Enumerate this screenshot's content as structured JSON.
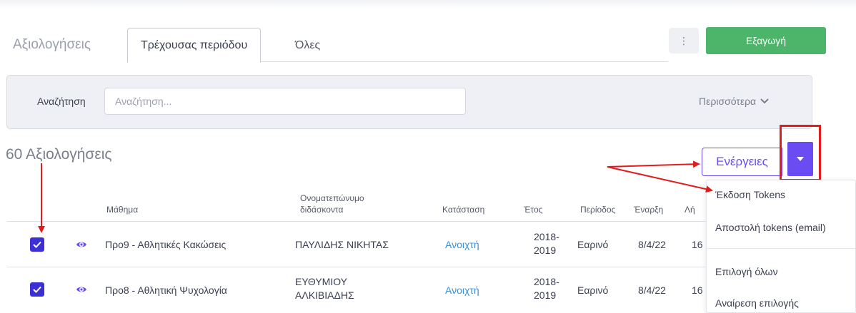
{
  "header": {
    "title": "Αξιολογήσεις",
    "tabs": [
      {
        "label": "Τρέχουσας περιόδου",
        "active": true
      },
      {
        "label": "Όλες",
        "active": false
      }
    ],
    "kebab_icon": "ellipsis-vertical-icon",
    "export_label": "Εξαγωγή"
  },
  "search": {
    "label": "Αναζήτηση",
    "placeholder": "Αναζήτηση...",
    "value": "",
    "more_label": "Περισσότερα"
  },
  "results": {
    "count_label": "60 Αξιολογήσεις",
    "actions_label": "Ενέργειες"
  },
  "table": {
    "columns": [
      "Μάθημα",
      "Ονοματεπώνυμο\nδιδάσκοντα",
      "Κατάσταση",
      "Έτος",
      "Περίοδος",
      "Έναρξη",
      "Λή"
    ],
    "rows": [
      {
        "course": "Προ9 - Αθλητικές Κακώσεις",
        "instructor": "ΠΑΥΛΙΔΗΣ ΝΙΚΗΤΑΣ",
        "status": "Ανοιχτή",
        "year": "2018-\n2019",
        "period": "Εαρινό",
        "start": "8/4/22",
        "end": "16",
        "checked": true
      },
      {
        "course": "Προ8 - Αθλητική Ψυχολογία",
        "instructor": "ΕΥΘΥΜΙΟΥ\nΑΛΚΙΒΙΑΔΗΣ",
        "status": "Ανοιχτή",
        "year": "2018-\n2019",
        "period": "Εαρινό",
        "start": "8/4/22",
        "end": "16",
        "checked": true
      }
    ]
  },
  "menu": {
    "items": [
      "Έκδοση Tokens",
      "Αποστολή tokens (email)",
      "Επιλογή όλων",
      "Αναίρεση επιλογής"
    ]
  },
  "colors": {
    "accent": "#6a4cf2",
    "export": "#4cb56a",
    "status_link": "#3d8fd6",
    "annotation": "#e31b1b"
  }
}
